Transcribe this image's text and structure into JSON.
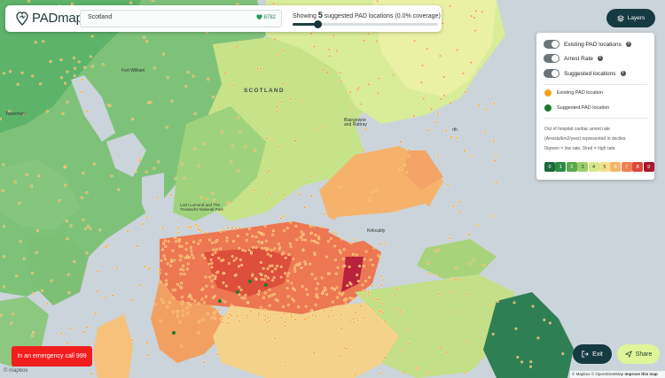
{
  "app": {
    "name": "PADmap"
  },
  "search": {
    "region": "Scotland",
    "population": "8782"
  },
  "summary": {
    "prefix": "Showing",
    "count": "5",
    "suffix": "suggested PAD locations (0.0% coverage)",
    "slider_fraction": 0.17
  },
  "layers_button": {
    "label": "Layers"
  },
  "layers_panel": {
    "toggles": [
      {
        "label": "Existing PAD locations",
        "on": true
      },
      {
        "label": "Arrest Rate",
        "on": true
      },
      {
        "label": "Suggested locations",
        "on": true
      }
    ],
    "legend": [
      {
        "label": "Existing PAD location",
        "color": "#f4a020"
      },
      {
        "label": "Suggested PAD location",
        "color": "#1e7a2e"
      }
    ],
    "note_line1": "Out of hospital cardiac arrest rate",
    "note_line2": "(Arrests/km2/year) represented in deciles",
    "note_line3": "0/green = low rate, 9/red = high rate",
    "deciles": [
      {
        "label": "0",
        "color": "#1a6b3a"
      },
      {
        "label": "1",
        "color": "#2e8b45"
      },
      {
        "label": "2",
        "color": "#5aa94f"
      },
      {
        "label": "3",
        "color": "#9ccf6a"
      },
      {
        "label": "4",
        "color": "#d6e98a"
      },
      {
        "label": "5",
        "color": "#f3e08a"
      },
      {
        "label": "6",
        "color": "#f6b66a"
      },
      {
        "label": "7",
        "color": "#ee8253"
      },
      {
        "label": "8",
        "color": "#dc4a3e"
      },
      {
        "label": "9",
        "color": "#a8182e"
      }
    ]
  },
  "map_labels": {
    "country": "SCOTLAND",
    "fort_william": "Fort William",
    "tobermory": "Tobermory",
    "blairgowrie": "Blairgowrie\nand Rattray",
    "perth_abbrev": "rth",
    "park": "Loch Lomond and The\nTrossachs National Park",
    "kirkcaldy": "Kirkcaldy"
  },
  "emergency": {
    "label": "In an emergency call 999"
  },
  "footer": {
    "mapbox": "© mapbox",
    "exit": "Exit",
    "share": "Share",
    "attribution": "© Mapbox © OpenStreetMap",
    "improve": "Improve this map"
  }
}
